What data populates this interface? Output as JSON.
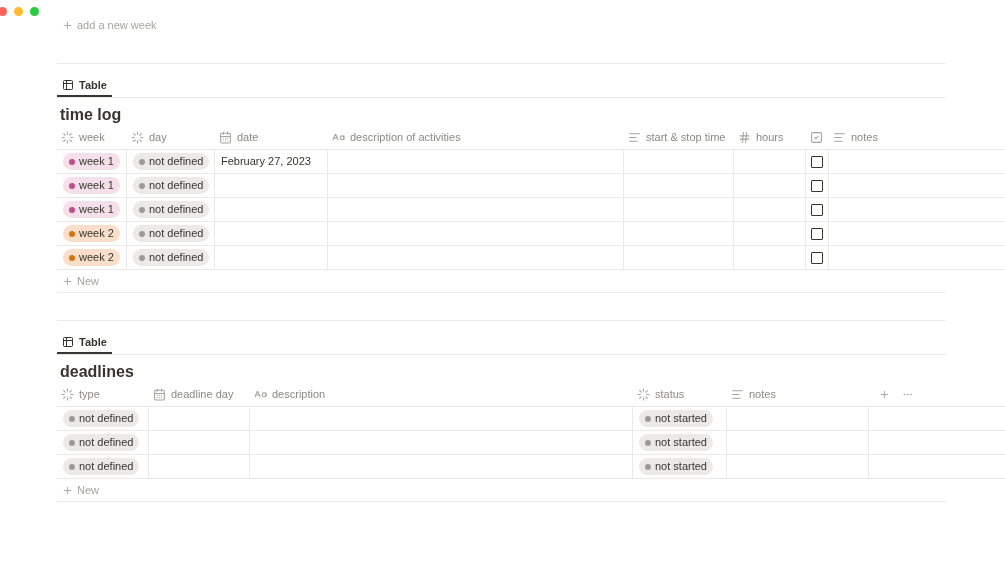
{
  "top_link": {
    "label": "add a new week"
  },
  "sections": [
    {
      "tab": {
        "label": "Table",
        "selected": true
      },
      "title": "time log",
      "columns": [
        {
          "label": "week",
          "kind": "select"
        },
        {
          "label": "day",
          "kind": "select"
        },
        {
          "label": "date",
          "kind": "date"
        },
        {
          "label": "description of activities",
          "kind": "title"
        },
        {
          "label": "start & stop time",
          "kind": "text"
        },
        {
          "label": "hours",
          "kind": "number"
        },
        {
          "kind": "checkbox"
        },
        {
          "label": "notes",
          "kind": "text"
        }
      ],
      "rows": [
        {
          "cells": [
            {
              "kind": "tag",
              "text": "week 1",
              "color": "#c14c8a"
            },
            {
              "kind": "tag",
              "text": "not defined",
              "color": "#9b9a97"
            },
            {
              "kind": "text",
              "text": "February 27, 2023"
            },
            {
              "kind": "empty"
            },
            {
              "kind": "empty"
            },
            {
              "kind": "empty"
            },
            {
              "kind": "checkbox",
              "checked": false
            },
            {
              "kind": "empty"
            }
          ]
        },
        {
          "cells": [
            {
              "kind": "tag",
              "text": "week 1",
              "color": "#c14c8a"
            },
            {
              "kind": "tag",
              "text": "not defined",
              "color": "#9b9a97"
            },
            {
              "kind": "empty"
            },
            {
              "kind": "empty"
            },
            {
              "kind": "empty"
            },
            {
              "kind": "empty"
            },
            {
              "kind": "checkbox",
              "checked": false
            },
            {
              "kind": "empty"
            }
          ]
        },
        {
          "cells": [
            {
              "kind": "tag",
              "text": "week 1",
              "color": "#c14c8a"
            },
            {
              "kind": "tag",
              "text": "not defined",
              "color": "#9b9a97"
            },
            {
              "kind": "empty"
            },
            {
              "kind": "empty"
            },
            {
              "kind": "empty"
            },
            {
              "kind": "empty"
            },
            {
              "kind": "checkbox",
              "checked": false
            },
            {
              "kind": "empty"
            }
          ]
        },
        {
          "cells": [
            {
              "kind": "tag",
              "text": "week 2",
              "color": "#d9730d"
            },
            {
              "kind": "tag",
              "text": "not defined",
              "color": "#9b9a97"
            },
            {
              "kind": "empty"
            },
            {
              "kind": "empty"
            },
            {
              "kind": "empty"
            },
            {
              "kind": "empty"
            },
            {
              "kind": "checkbox",
              "checked": false
            },
            {
              "kind": "empty"
            }
          ]
        },
        {
          "cells": [
            {
              "kind": "tag",
              "text": "week 2",
              "color": "#d9730d"
            },
            {
              "kind": "tag",
              "text": "not defined",
              "color": "#9b9a97"
            },
            {
              "kind": "empty"
            },
            {
              "kind": "empty"
            },
            {
              "kind": "empty"
            },
            {
              "kind": "empty"
            },
            {
              "kind": "checkbox",
              "checked": false
            },
            {
              "kind": "empty"
            }
          ]
        }
      ],
      "new_label": "New"
    },
    {
      "tab": {
        "label": "Table",
        "selected": true
      },
      "title": "deadlines",
      "columns": [
        {
          "label": "type",
          "kind": "select"
        },
        {
          "label": "deadline day",
          "kind": "date"
        },
        {
          "label": "description",
          "kind": "title"
        },
        {
          "label": "status",
          "kind": "select"
        },
        {
          "label": "notes",
          "kind": "text"
        },
        {
          "kind": "actions"
        }
      ],
      "rows": [
        {
          "cells": [
            {
              "kind": "tag",
              "text": "not defined",
              "color": "#9b9a97"
            },
            {
              "kind": "empty"
            },
            {
              "kind": "empty"
            },
            {
              "kind": "tag",
              "text": "not started",
              "color": "#9b9a97"
            },
            {
              "kind": "empty"
            },
            {
              "kind": "empty"
            }
          ]
        },
        {
          "cells": [
            {
              "kind": "tag",
              "text": "not defined",
              "color": "#9b9a97"
            },
            {
              "kind": "empty"
            },
            {
              "kind": "empty"
            },
            {
              "kind": "tag",
              "text": "not started",
              "color": "#9b9a97"
            },
            {
              "kind": "empty"
            },
            {
              "kind": "empty"
            }
          ]
        },
        {
          "cells": [
            {
              "kind": "tag",
              "text": "not defined",
              "color": "#9b9a97"
            },
            {
              "kind": "empty"
            },
            {
              "kind": "empty"
            },
            {
              "kind": "tag",
              "text": "not started",
              "color": "#9b9a97"
            },
            {
              "kind": "empty"
            },
            {
              "kind": "empty"
            }
          ]
        }
      ],
      "new_label": "New"
    }
  ]
}
